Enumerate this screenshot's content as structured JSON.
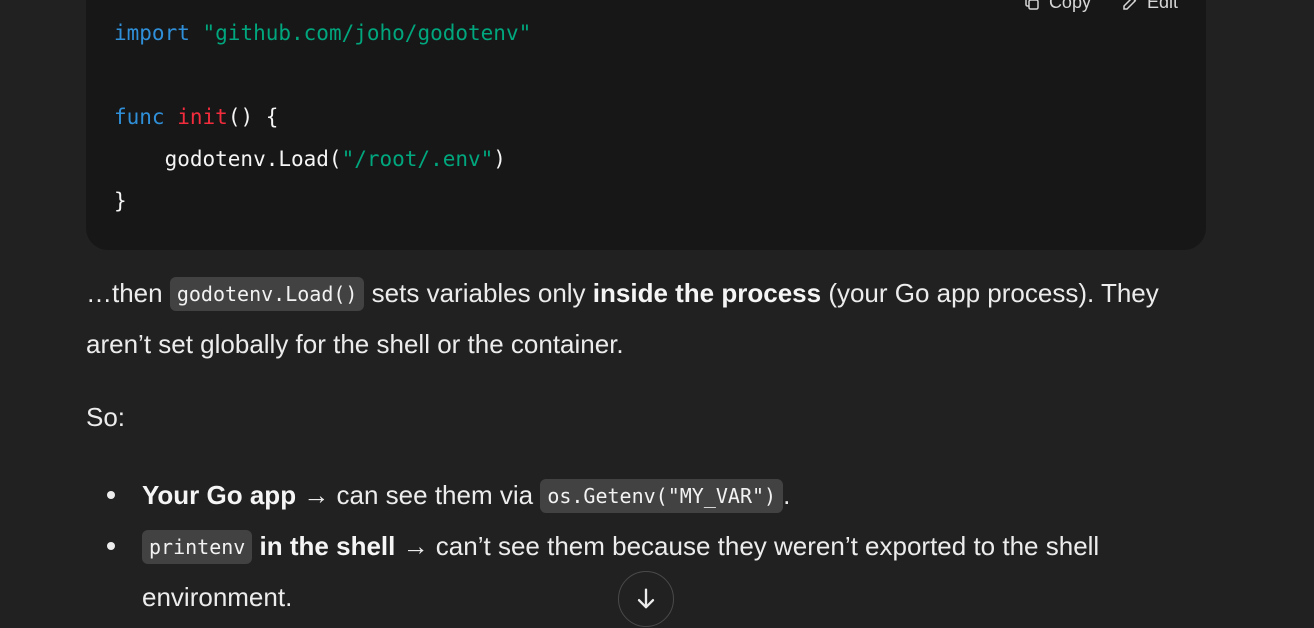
{
  "code_block": {
    "actions": {
      "copy_label": "Copy",
      "edit_label": "Edit"
    },
    "lines": {
      "l1_kw": "import",
      "l1_str": "\"github.com/joho/godotenv\"",
      "l3_kw": "func",
      "l3_fn": "init",
      "l3_rest": "() {",
      "l4_pre": "    godotenv.Load(",
      "l4_str": "\"/root/.env\"",
      "l4_post": ")",
      "l5": "}"
    }
  },
  "paragraph1": {
    "t1": "…then ",
    "code1": "godotenv.Load()",
    "t2": " sets variables only ",
    "bold1": "inside the process",
    "t3": " (your Go app process). They aren’t set globally for the shell or the container."
  },
  "paragraph2": {
    "text": "So:"
  },
  "bullets": [
    {
      "bold": "Your Go app",
      "t1": " → can see them via ",
      "code": "os.Getenv(\"MY_VAR\")",
      "t2": "."
    },
    {
      "code": "printenv",
      "bold": " in the shell",
      "t1": " → can’t see them because they weren’t exported to the shell environment."
    }
  ],
  "scroll_button": {
    "icon": "arrow-down-icon"
  }
}
